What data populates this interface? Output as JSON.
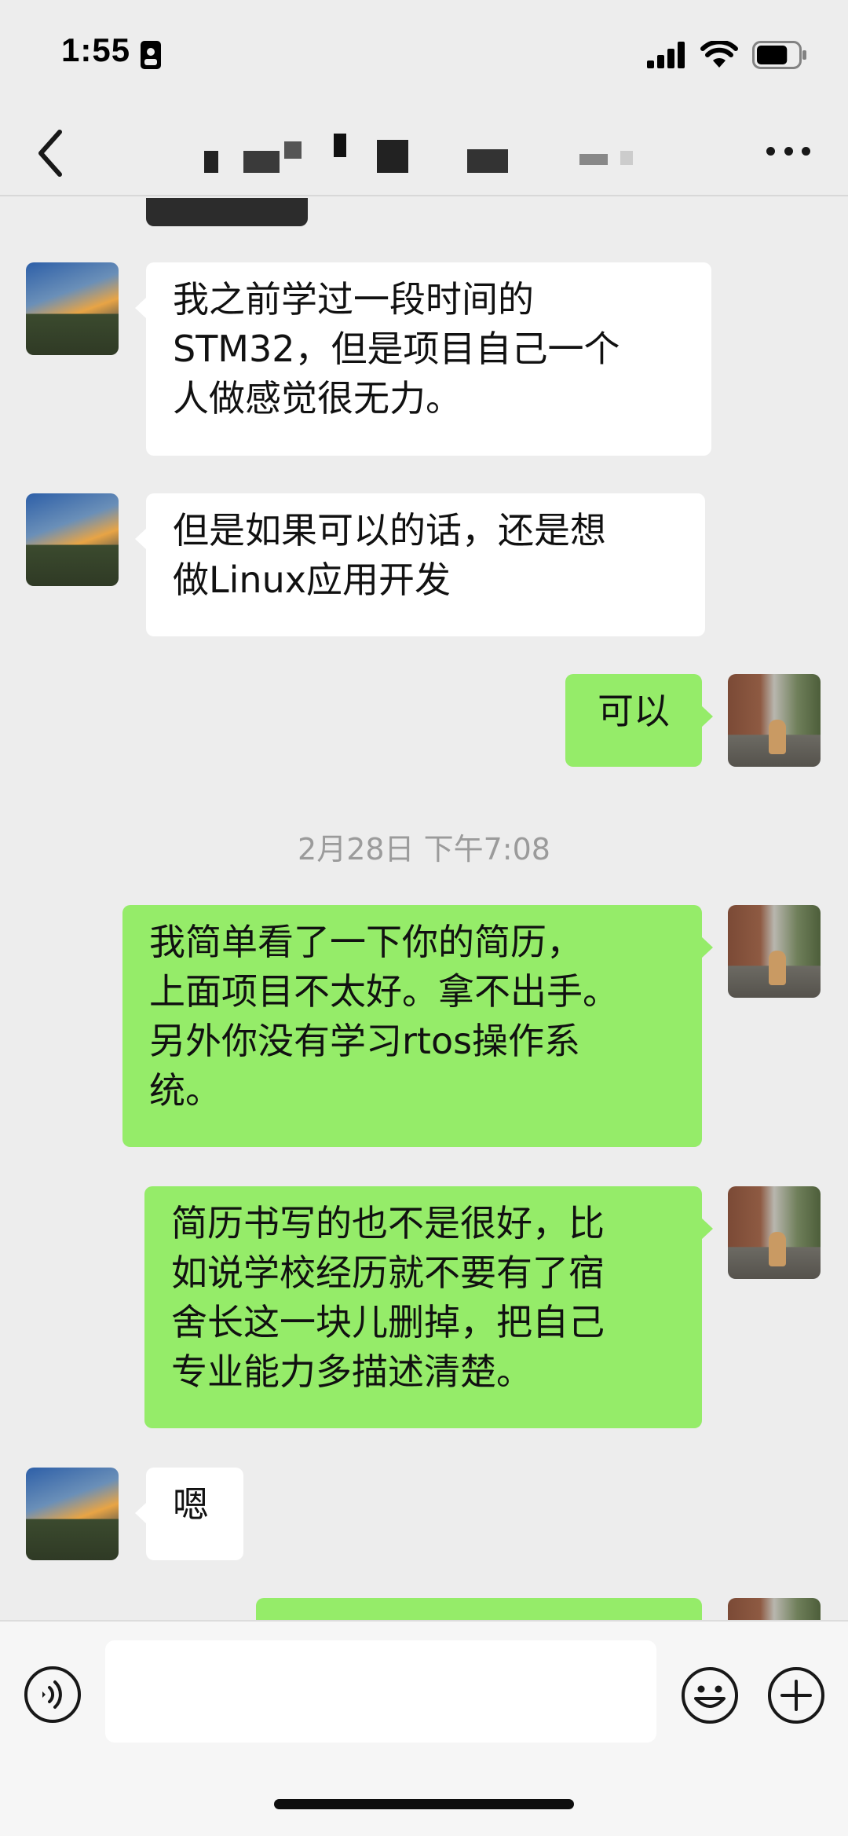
{
  "status_bar": {
    "time": "1:55",
    "battery_level": 0.75
  },
  "nav": {
    "title": "██▖▘▌ ▛▖ ▀▝"
  },
  "messages": [
    {
      "side": "in",
      "text": "我之前学过一段时间的\nSTM32，但是项目自己一个\n人做感觉很无力。"
    },
    {
      "side": "in",
      "text": "但是如果可以的话，还是想\n做Linux应用开发"
    },
    {
      "side": "out",
      "text": "可以"
    },
    {
      "side": "time",
      "text": "2月28日 下午7:08"
    },
    {
      "side": "out",
      "text": "我简单看了一下你的简历，\n上面项目不太好。拿不出手。\n另外你没有学习rtos操作系\n统。"
    },
    {
      "side": "out",
      "text": "简历书写的也不是很好，比\n如说学校经历就不要有了宿\n舍长这一块儿删掉，把自己\n专业能力多描述清楚。"
    },
    {
      "side": "in",
      "text": "嗯"
    }
  ],
  "input": {
    "value": ""
  },
  "icons": {
    "back": "chevron-left-icon",
    "more": "more-dots-icon",
    "voice": "voice-icon",
    "emoji": "emoji-icon",
    "plus": "plus-icon"
  },
  "colors": {
    "background": "#ededed",
    "incoming_bubble": "#ffffff",
    "outgoing_bubble": "#95ec69",
    "timestamp_text": "#9b9b9b"
  }
}
